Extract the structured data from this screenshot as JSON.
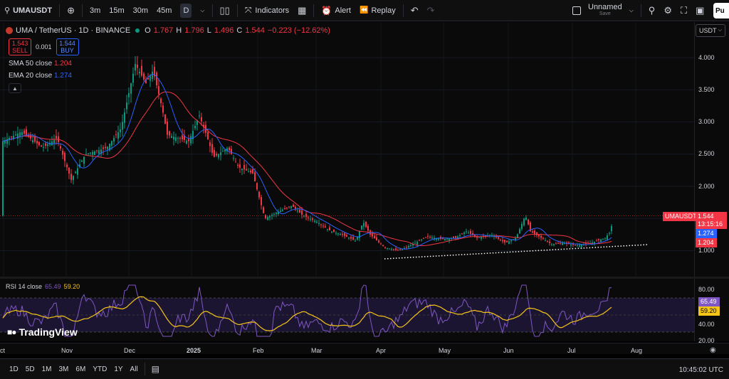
{
  "toolbar": {
    "symbol": "UMAUSDT",
    "timeframes": [
      "3m",
      "15m",
      "30m",
      "45m"
    ],
    "active_timeframe": "D",
    "indicators_label": "Indicators",
    "alert_label": "Alert",
    "replay_label": "Replay",
    "layout_name": "Unnamed",
    "layout_status": "Save",
    "publish_label": "Pu"
  },
  "legend": {
    "title": "UMA / TetherUS · 1D · BINANCE",
    "o_key": "O",
    "o": "1.767",
    "h_key": "H",
    "h": "1.796",
    "l_key": "L",
    "l": "1.496",
    "c_key": "C",
    "c": "1.544",
    "change": "−0.223 (−12.62%)"
  },
  "trade": {
    "sell_price": "1.543",
    "sell_label": "SELL",
    "spread": "0.001",
    "buy_price": "1.544",
    "buy_label": "BUY"
  },
  "indicators": {
    "sma_label": "SMA 50 close",
    "sma_value": "1.204",
    "ema_label": "EMA 20 close",
    "ema_value": "1.274"
  },
  "currency": "USDT",
  "price_axis": [
    "4.000",
    "3.500",
    "3.000",
    "2.500",
    "2.000",
    "1.000"
  ],
  "price_tags": {
    "symbol": "UMAUSDT",
    "last": "1.544",
    "countdown": "13:15:16",
    "ema": "1.274",
    "sma": "1.204"
  },
  "rsi": {
    "label": "RSI 14 close",
    "value": "65.49",
    "ma_value": "59.20",
    "axis": [
      "80.00",
      "40.00",
      "20.00"
    ]
  },
  "watermark": "TradingView",
  "time_axis": [
    "ct",
    "Nov",
    "Dec",
    "2025",
    "Feb",
    "Mar",
    "Apr",
    "May",
    "Jun",
    "Jul",
    "Aug"
  ],
  "ranges": [
    "1D",
    "5D",
    "1M",
    "3M",
    "6M",
    "YTD",
    "1Y",
    "All"
  ],
  "clock": "10:45:02 UTC",
  "colors": {
    "up": "#089981",
    "down": "#f23645",
    "sma": "#f23645",
    "ema": "#2962ff",
    "rsi": "#7e57c2",
    "rsi_ma": "#f5c518"
  },
  "chart_data": {
    "type": "candlestick",
    "x": [
      "2024-10-01",
      "2024-11-01",
      "2024-12-01",
      "2025-01-01",
      "2025-02-01",
      "2025-03-01",
      "2025-04-01",
      "2025-05-01",
      "2025-06-01",
      "2025-07-01",
      "2025-07-19"
    ],
    "close": [
      2.7,
      2.2,
      3.9,
      2.7,
      2.4,
      1.5,
      1.05,
      1.2,
      1.25,
      1.1,
      1.544
    ],
    "ylim": [
      0.9,
      4.3
    ]
  }
}
